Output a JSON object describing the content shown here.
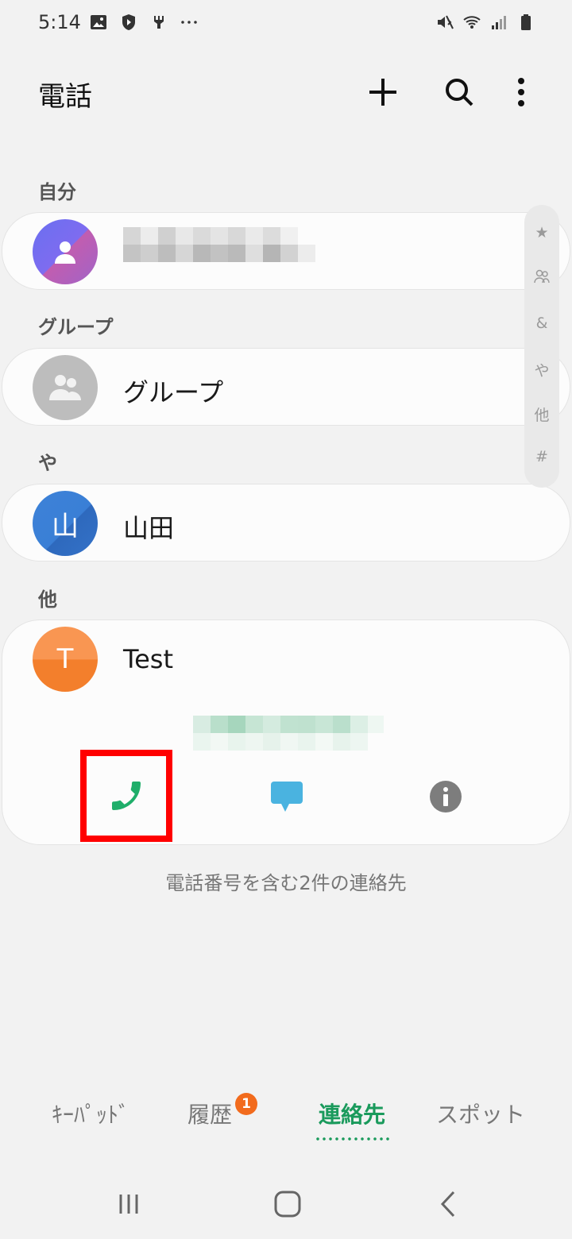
{
  "status_bar": {
    "time": "5:14",
    "left_icons": [
      "image-icon",
      "shield-icon",
      "usb-icon",
      "more-dots-icon"
    ],
    "right_icons": [
      "mute-vibrate-icon",
      "wifi-icon",
      "signal-icon",
      "battery-icon"
    ]
  },
  "app_bar": {
    "title": "電話",
    "actions": [
      "add-icon",
      "search-icon",
      "more-vert-icon"
    ]
  },
  "sections": {
    "me": {
      "header": "自分"
    },
    "groups": {
      "header": "グループ",
      "item_label": "グループ"
    },
    "ya": {
      "header": "や",
      "contact_name": "山田",
      "avatar_letter": "山"
    },
    "other": {
      "header": "他",
      "contact_name": "Test",
      "avatar_letter": "T",
      "actions": [
        "phone-icon",
        "message-icon",
        "info-icon"
      ]
    }
  },
  "index_scroller": [
    "★",
    "group-icon",
    "&",
    "や",
    "他",
    "#"
  ],
  "footer": {
    "text": "電話番号を含む2件の連絡先"
  },
  "tabs": {
    "keypad": "ｷｰﾊﾟｯﾄﾞ",
    "recents": "履歴",
    "recents_badge": "1",
    "contacts": "連絡先",
    "spot": "スポット"
  },
  "colors": {
    "accent": "#1a9a5c",
    "badge": "#f26b1d",
    "highlight": "#ff0000",
    "phone": "#1fae6a",
    "message": "#4ab3e0"
  },
  "nav": [
    "recents-icon",
    "home-icon",
    "back-icon"
  ]
}
